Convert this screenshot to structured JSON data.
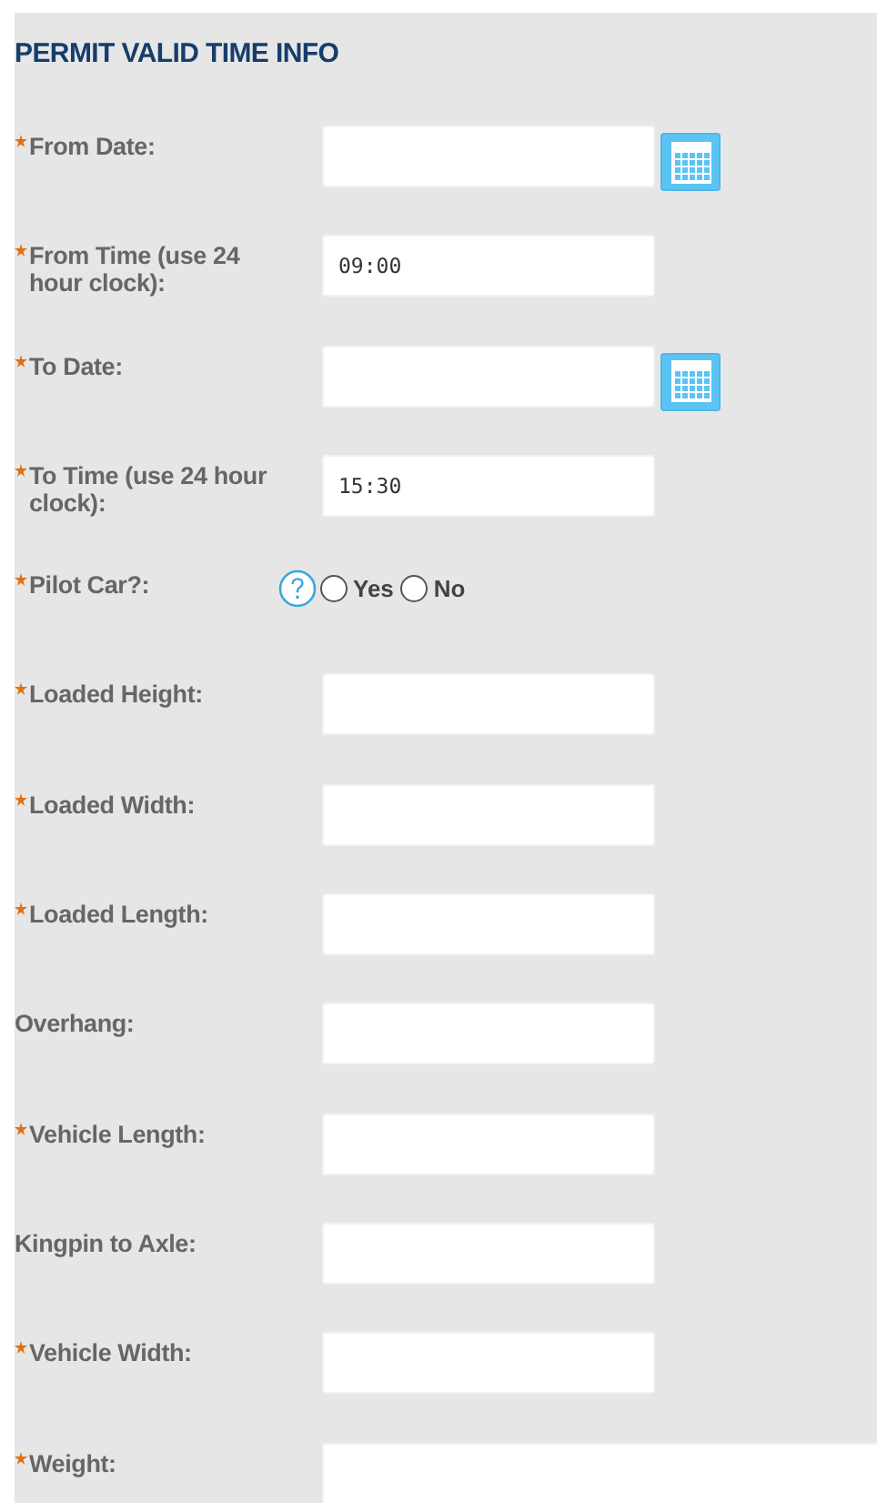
{
  "section_title": "PERMIT VALID TIME INFO",
  "fields": [
    {
      "kind": "date",
      "label": "From Date:",
      "required": true
    },
    {
      "kind": "text",
      "label": "From Time (use 24 hour clock):",
      "required": true,
      "value": "09:00"
    },
    {
      "kind": "date",
      "label": "To Date:",
      "required": true
    },
    {
      "kind": "text",
      "label": "To Time (use 24 hour clock):",
      "required": true,
      "value": "15:30"
    },
    {
      "kind": "radio",
      "label": "Pilot Car?:",
      "required": true,
      "options": [
        {
          "label": "Yes",
          "selected": false
        },
        {
          "label": "No",
          "selected": false
        }
      ]
    },
    {
      "kind": "text",
      "label": "Loaded Height:",
      "required": true
    },
    {
      "kind": "text",
      "label": "Loaded Width:",
      "required": true
    },
    {
      "kind": "text",
      "label": "Loaded Length:",
      "required": true
    },
    {
      "kind": "text",
      "label": "Overhang:",
      "required": false
    },
    {
      "kind": "text",
      "label": "Vehicle Length:",
      "required": true
    },
    {
      "kind": "text",
      "label": "Kingpin to Axle:",
      "required": false
    },
    {
      "kind": "text",
      "label": "Vehicle Width:",
      "required": true
    },
    {
      "kind": "wide",
      "label": "Weight:",
      "required": true
    }
  ]
}
